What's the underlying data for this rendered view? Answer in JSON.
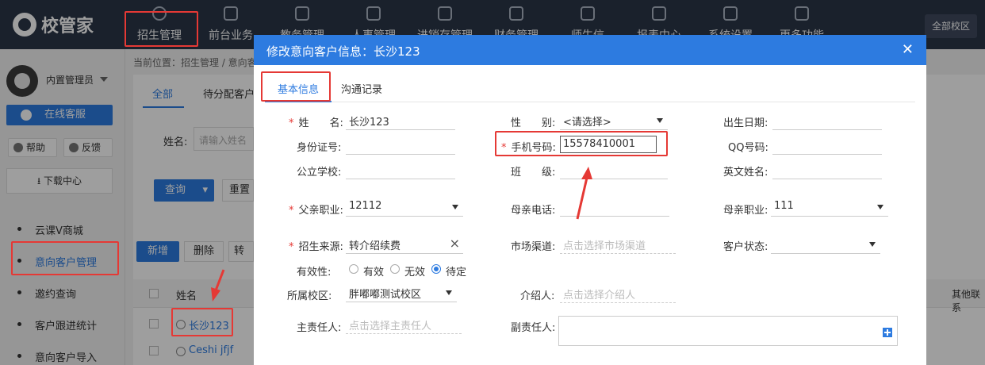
{
  "app": {
    "logo_text": "校管家",
    "campus_button": "全部校区"
  },
  "nav": [
    {
      "label": "招生管理",
      "icon": "user-add-icon"
    },
    {
      "label": "前台业务",
      "icon": "monitor-icon"
    },
    {
      "label": "教务管理",
      "icon": "book-icon"
    },
    {
      "label": "人事管理",
      "icon": "person-icon"
    },
    {
      "label": "进销存管理",
      "icon": "import-icon"
    },
    {
      "label": "财务管理",
      "icon": "home-money-icon"
    },
    {
      "label": "师生信",
      "icon": "chat-icon"
    },
    {
      "label": "报表中心",
      "icon": "chart-icon"
    },
    {
      "label": "系统设置",
      "icon": "settings-icon"
    },
    {
      "label": "更多功能",
      "icon": "more-icon"
    }
  ],
  "sidebar": {
    "user_name": "内置管理员",
    "online_service": "在线客服",
    "help": "帮助",
    "feedback": "反馈",
    "download_center": "下载中心",
    "items": [
      {
        "label": "云课V商城"
      },
      {
        "label": "意向客户管理"
      },
      {
        "label": "邀约查询"
      },
      {
        "label": "客户跟进统计"
      },
      {
        "label": "意向客户导入"
      }
    ]
  },
  "main": {
    "breadcrumb": "当前位置：招生管理 / 意向客",
    "tabs": [
      "全部",
      "待分配客户"
    ],
    "filter_name_label": "姓名:",
    "filter_name_placeholder": "请输入姓名",
    "query_button": "查询",
    "reset_button": "重置",
    "toolbar": {
      "new": "新增",
      "delete": "删除",
      "more": "转为"
    },
    "table": {
      "header_name": "姓名",
      "header_other": "其他联系",
      "rows": [
        {
          "name": "长沙123"
        },
        {
          "name": "Ceshi jfjf"
        }
      ]
    }
  },
  "modal": {
    "title": "修改意向客户信息：长沙123",
    "close": "✕",
    "tabs": {
      "basic": "基本信息",
      "comm": "沟通记录"
    },
    "fields": {
      "name_label": "姓　　名:",
      "name_value": "长沙123",
      "gender_label": "性　　别:",
      "gender_value": "<请选择>",
      "birth_label": "出生日期:",
      "idcard_label": "身份证号:",
      "phone_label": "手机号码:",
      "phone_value": "15578410001",
      "qq_label": "QQ号码:",
      "school_label": "公立学校:",
      "class_label": "班　　级:",
      "english_label": "英文姓名:",
      "father_job_label": "父亲职业:",
      "father_job_value": "12112",
      "mother_phone_label": "母亲电话:",
      "mother_job_label": "母亲职业:",
      "mother_job_value": "111",
      "source_label": "招生来源:",
      "source_value": "转介绍续费",
      "channel_label": "市场渠道:",
      "channel_placeholder": "点击选择市场渠道",
      "status_label": "客户状态:",
      "validity_label": "有效性:",
      "validity_options": [
        "有效",
        "无效",
        "待定"
      ],
      "campus_label": "所属校区:",
      "campus_value": "胖嘟嘟测试校区",
      "referrer_label": "介绍人:",
      "referrer_placeholder": "点击选择介绍人",
      "owner_label": "主责任人:",
      "owner_placeholder": "点击选择主责任人",
      "co_owner_label": "副责任人:"
    }
  },
  "colors": {
    "accent": "#2d7be0",
    "nav_bg": "#2b3648",
    "annotation_red": "#e53935"
  }
}
